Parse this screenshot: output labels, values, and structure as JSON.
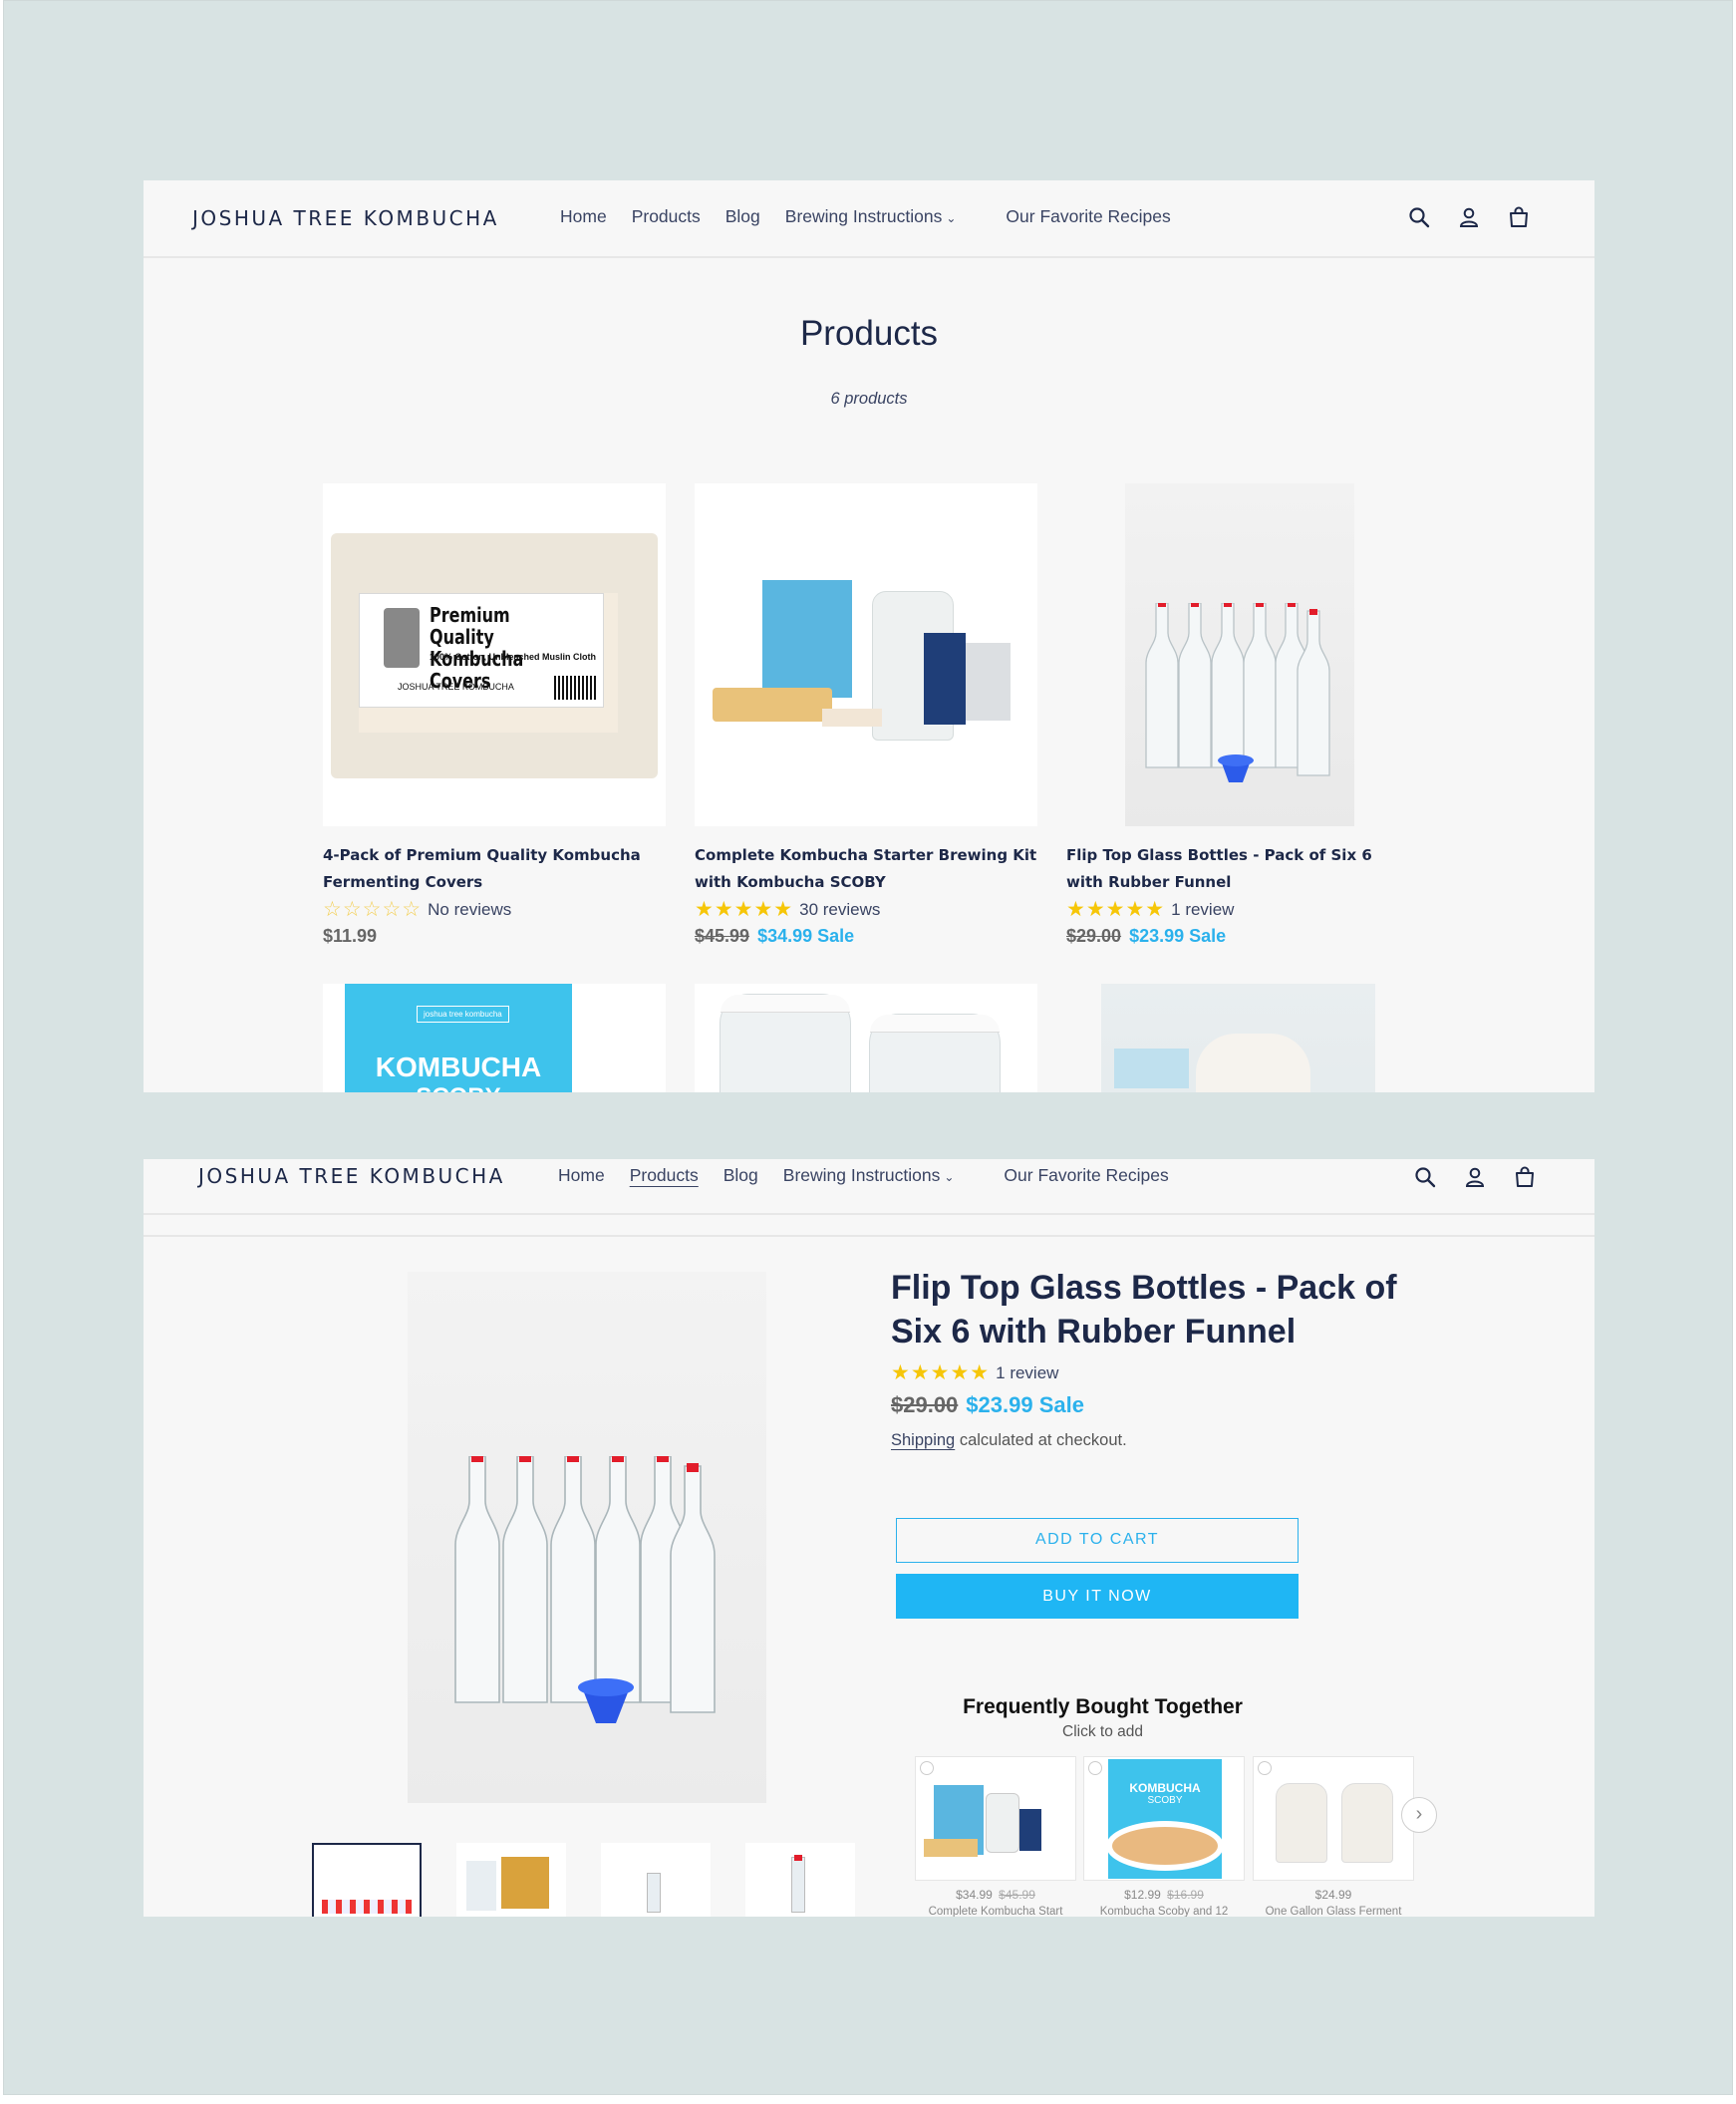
{
  "brand": "JOSHUA TREE KOMBUCHA",
  "nav": {
    "home": "Home",
    "products": "Products",
    "blog": "Blog",
    "brewing": "Brewing Instructions",
    "recipes": "Our Favorite Recipes"
  },
  "icons": {
    "search": "search-icon",
    "account": "account-icon",
    "cart": "cart-icon",
    "chevron": "chevron-down-icon"
  },
  "colors": {
    "accent": "#1fb6f4",
    "sale": "#2bb1ec",
    "star": "#f6c608",
    "backdrop": "#d8e3e3"
  },
  "collection": {
    "title": "Products",
    "count": "6 products",
    "products": [
      {
        "name": "4-Pack of Premium Quality Kombucha Fermenting Covers",
        "stars": "☆☆☆☆☆",
        "reviews": "No reviews",
        "price": "$11.99",
        "image_text_1": "Premium Quality",
        "image_text_2": "Kombucha Covers",
        "image_text_3": "100% Cotton, Unbleached Muslin Cloth",
        "image_text_4": "JOSHUA TREE KOMBUCHA"
      },
      {
        "name": "Complete Kombucha Starter Brewing Kit with Kombucha SCOBY",
        "stars": "★★★★★",
        "reviews": "30 reviews",
        "old_price": "$45.99",
        "sale_price": "$34.99 Sale"
      },
      {
        "name": "Flip Top Glass Bottles - Pack of Six 6 with Rubber Funnel",
        "stars": "★★★★★",
        "reviews": "1 review",
        "old_price": "$29.00",
        "sale_price": "$23.99 Sale"
      },
      {
        "name": "",
        "image_text_1": "joshua tree kombucha",
        "image_text_2": "KOMBUCHA",
        "image_text_3": "SCOBY"
      }
    ]
  },
  "product": {
    "title": "Flip Top Glass Bottles - Pack of Six 6 with Rubber Funnel",
    "stars": "★★★★★",
    "reviews": "1 review",
    "old_price": "$29.00",
    "sale_price": "$23.99 Sale",
    "shipping_link": "Shipping",
    "shipping_text": " calculated at checkout.",
    "add_to_cart": "ADD TO CART",
    "buy_now": "BUY IT NOW",
    "fbt": {
      "title": "Frequently Bought Together",
      "subtitle": "Click to add",
      "next_icon": "chevron-right-icon",
      "items": [
        {
          "price": "$34.99",
          "old_price": "$45.99",
          "name": "Complete Kombucha Start"
        },
        {
          "price": "$12.99",
          "old_price": "$16.99",
          "name": "Kombucha Scoby and 12",
          "image_text_1": "KOMBUCHA",
          "image_text_2": "SCOBY"
        },
        {
          "price": "$24.99",
          "old_price": "",
          "name": "One Gallon Glass Ferment"
        }
      ]
    }
  }
}
